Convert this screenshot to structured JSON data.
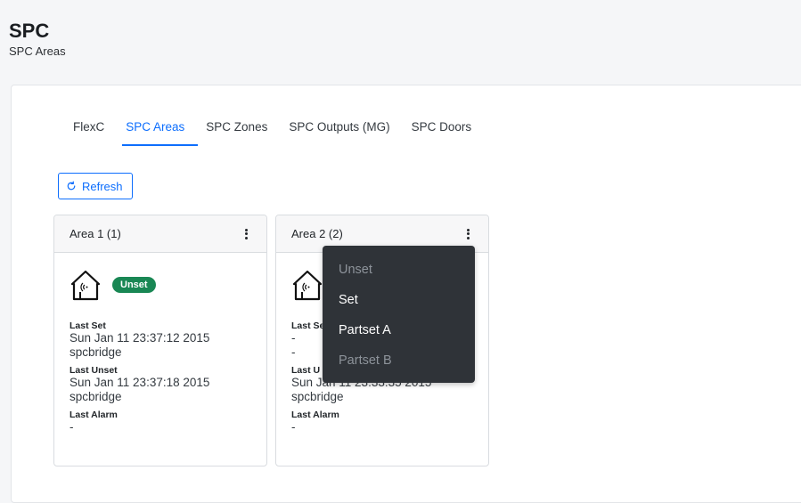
{
  "header": {
    "title": "SPC",
    "subtitle": "SPC Areas"
  },
  "tabs": [
    {
      "label": "FlexC",
      "active": false
    },
    {
      "label": "SPC Areas",
      "active": true
    },
    {
      "label": "SPC Zones",
      "active": false
    },
    {
      "label": "SPC Outputs (MG)",
      "active": false
    },
    {
      "label": "SPC Doors",
      "active": false
    }
  ],
  "toolbar": {
    "refresh_label": "Refresh",
    "refresh_icon": "refresh-icon"
  },
  "colors": {
    "accent": "#0d6efd",
    "badge_green": "#198754",
    "dropdown_bg": "#2f3338"
  },
  "cards": [
    {
      "title": "Area 1 (1)",
      "status": "Unset",
      "last_set_label": "Last Set",
      "last_set_time": "Sun Jan 11 23:37:12 2015",
      "last_set_user": "spcbridge",
      "last_unset_label": "Last Unset",
      "last_unset_time": "Sun Jan 11 23:37:18 2015",
      "last_unset_user": "spcbridge",
      "last_alarm_label": "Last Alarm",
      "last_alarm_value": "-"
    },
    {
      "title": "Area 2 (2)",
      "status": "",
      "last_set_label": "Last Se",
      "last_set_time": "-",
      "last_set_user": "-",
      "last_unset_label": "Last U",
      "last_unset_time": "Sun Jan 11 23:33:35 2015",
      "last_unset_user": "spcbridge",
      "last_alarm_label": "Last Alarm",
      "last_alarm_value": "-"
    }
  ],
  "dropdown": {
    "items": [
      {
        "label": "Unset",
        "disabled": true
      },
      {
        "label": "Set",
        "disabled": false
      },
      {
        "label": "Partset A",
        "disabled": false
      },
      {
        "label": "Partset B",
        "disabled": true
      }
    ]
  }
}
